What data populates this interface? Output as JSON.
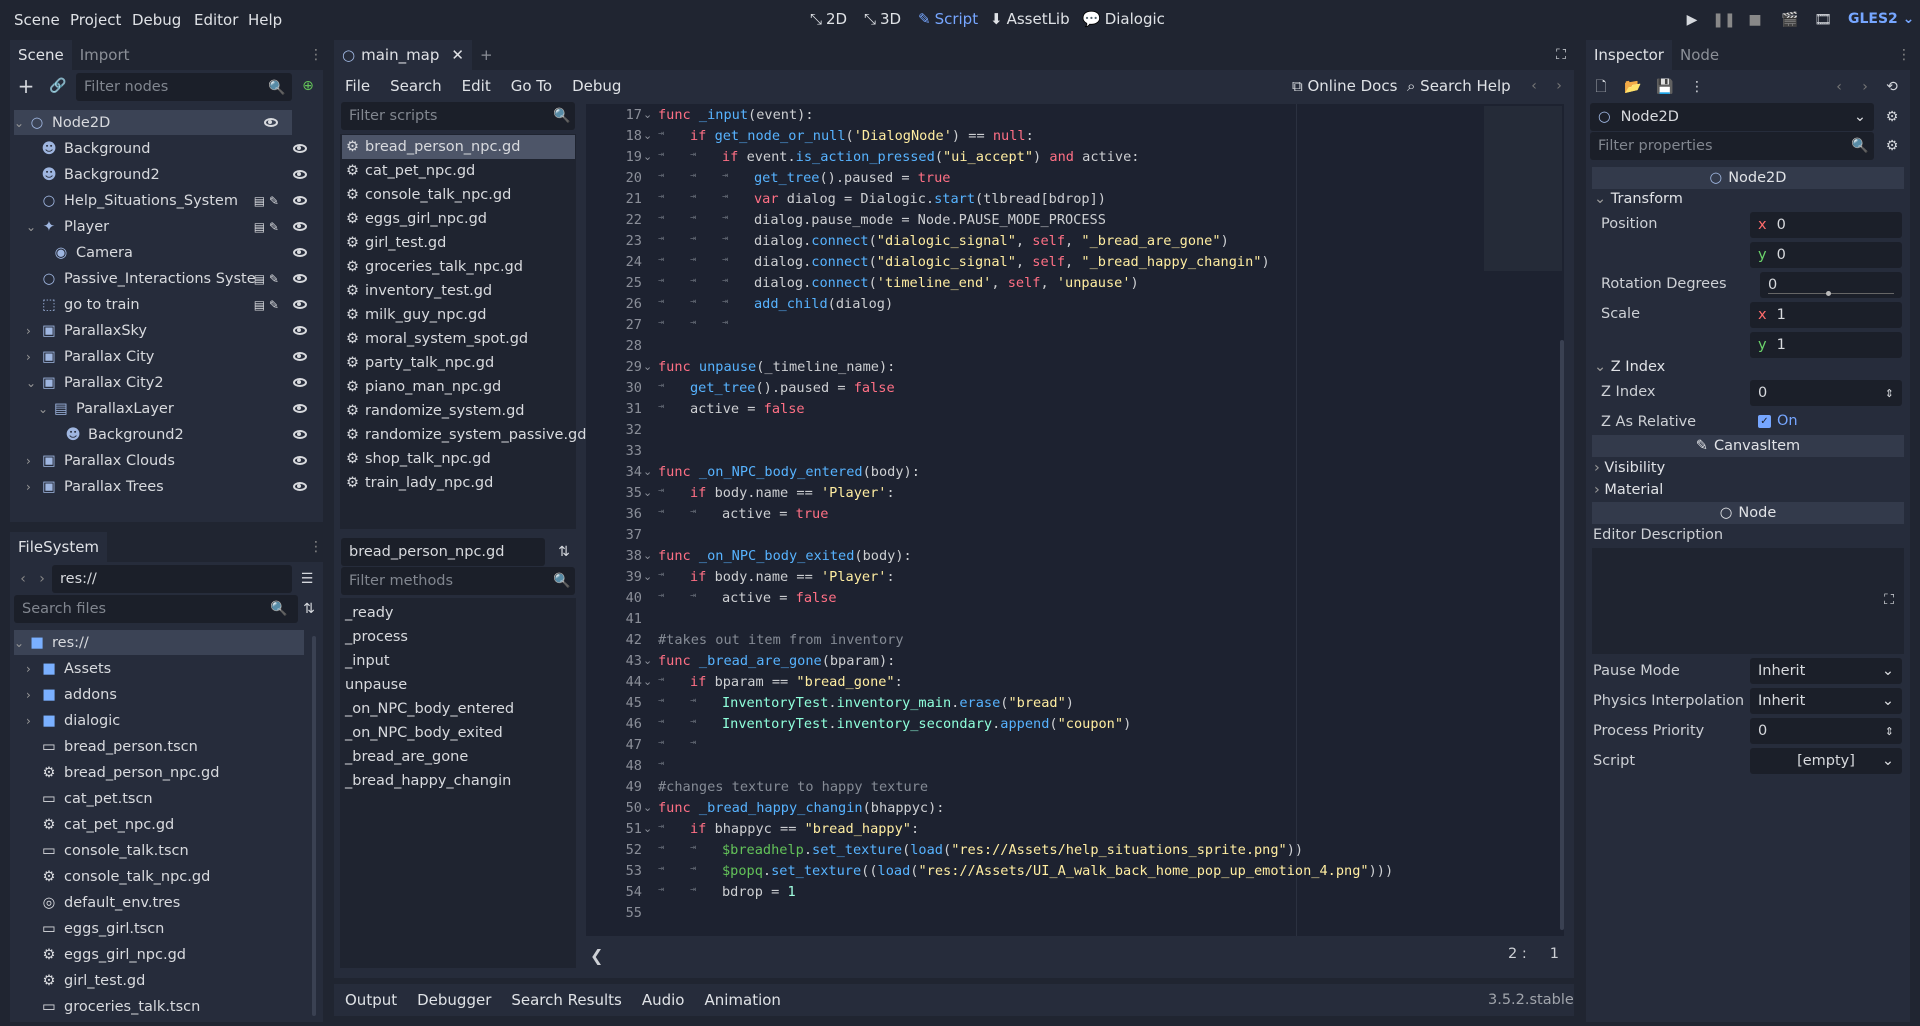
{
  "menus": [
    "Scene",
    "Project",
    "Debug",
    "Editor",
    "Help"
  ],
  "workspaces": [
    "2D",
    "3D",
    "Script",
    "AssetLib",
    "Dialogic"
  ],
  "active_workspace": "Script",
  "renderer": "GLES2",
  "scene_panel": {
    "tabs": [
      "Scene",
      "Import"
    ],
    "filter_placeholder": "Filter nodes",
    "nodes": [
      {
        "label": "Node2D",
        "depth": 0,
        "icon": "node2d-icon"
      },
      {
        "label": "Background",
        "depth": 1,
        "icon": "sprite-icon"
      },
      {
        "label": "Background2",
        "depth": 1,
        "icon": "sprite-icon"
      },
      {
        "label": "Help_Situations_System",
        "depth": 1,
        "icon": "node2d-icon"
      },
      {
        "label": "Player",
        "depth": 1,
        "icon": "kinematic-icon"
      },
      {
        "label": "Camera",
        "depth": 2,
        "icon": "camera-icon"
      },
      {
        "label": "Passive_Interactions Syste",
        "depth": 1,
        "icon": "node2d-icon"
      },
      {
        "label": "go to train",
        "depth": 1,
        "icon": "area-icon"
      },
      {
        "label": "ParallaxSky",
        "depth": 1,
        "icon": "parallax-icon"
      },
      {
        "label": "Parallax City",
        "depth": 1,
        "icon": "parallax-icon"
      },
      {
        "label": "Parallax City2",
        "depth": 1,
        "icon": "parallax-icon"
      },
      {
        "label": "ParallaxLayer",
        "depth": 2,
        "icon": "parallax-layer-icon"
      },
      {
        "label": "Background2",
        "depth": 3,
        "icon": "sprite-icon"
      },
      {
        "label": "Parallax Clouds",
        "depth": 1,
        "icon": "parallax-icon"
      },
      {
        "label": "Parallax Trees",
        "depth": 1,
        "icon": "parallax-icon"
      }
    ]
  },
  "filesystem": {
    "tab": "FileSystem",
    "path": "res://",
    "search_placeholder": "Search files",
    "items": [
      {
        "label": "res://",
        "icon": "folder-icon",
        "depth": 0
      },
      {
        "label": "Assets",
        "icon": "folder-icon",
        "depth": 1
      },
      {
        "label": "addons",
        "icon": "folder-icon",
        "depth": 1
      },
      {
        "label": "dialogic",
        "icon": "folder-icon",
        "depth": 1
      },
      {
        "label": "bread_person.tscn",
        "icon": "scene-icon",
        "depth": 1
      },
      {
        "label": "bread_person_npc.gd",
        "icon": "gear-icon",
        "depth": 1
      },
      {
        "label": "cat_pet.tscn",
        "icon": "scene-icon",
        "depth": 1
      },
      {
        "label": "cat_pet_npc.gd",
        "icon": "gear-icon",
        "depth": 1
      },
      {
        "label": "console_talk.tscn",
        "icon": "scene-icon",
        "depth": 1
      },
      {
        "label": "console_talk_npc.gd",
        "icon": "gear-icon",
        "depth": 1
      },
      {
        "label": "default_env.tres",
        "icon": "globe-icon",
        "depth": 1
      },
      {
        "label": "eggs_girl.tscn",
        "icon": "scene-icon",
        "depth": 1
      },
      {
        "label": "eggs_girl_npc.gd",
        "icon": "gear-icon",
        "depth": 1
      },
      {
        "label": "girl_test.gd",
        "icon": "gear-icon",
        "depth": 1
      },
      {
        "label": "groceries_talk.tscn",
        "icon": "scene-icon",
        "depth": 1
      }
    ]
  },
  "editor": {
    "scene_tab": "main_map",
    "menus": [
      "File",
      "Search",
      "Edit",
      "Go To",
      "Debug"
    ],
    "online_docs": "Online Docs",
    "search_help": "Search Help",
    "filter_scripts": "Filter scripts",
    "scripts": [
      "bread_person_npc.gd",
      "cat_pet_npc.gd",
      "console_talk_npc.gd",
      "eggs_girl_npc.gd",
      "girl_test.gd",
      "groceries_talk_npc.gd",
      "inventory_test.gd",
      "milk_guy_npc.gd",
      "moral_system_spot.gd",
      "party_talk_npc.gd",
      "piano_man_npc.gd",
      "randomize_system.gd",
      "randomize_system_passive.gd",
      "shop_talk_npc.gd",
      "train_lady_npc.gd"
    ],
    "current_script": "bread_person_npc.gd",
    "filter_methods": "Filter methods",
    "methods": [
      "_ready",
      "_process",
      "_input",
      "unpause",
      "_on_NPC_body_entered",
      "_on_NPC_body_exited",
      "_bread_are_gone",
      "_bread_happy_changin"
    ],
    "cursor_line": "2",
    "cursor_col": "1",
    "bottom_tabs": [
      "Output",
      "Debugger",
      "Search Results",
      "Audio",
      "Animation"
    ],
    "version": "3.5.2.stable",
    "code_lines": [
      {
        "n": "17",
        "fold": true,
        "indent": 0,
        "t": [
          [
            "kw",
            "func "
          ],
          [
            "fn",
            "_input"
          ],
          [
            "tx",
            "(event):"
          ]
        ]
      },
      {
        "n": "18",
        "fold": true,
        "indent": 1,
        "t": [
          [
            "kw",
            "if "
          ],
          [
            "fn",
            "get_node_or_null"
          ],
          [
            "tx",
            "("
          ],
          [
            "st",
            "'DialogNode'"
          ],
          [
            "tx",
            ") == "
          ],
          [
            "kw",
            "null"
          ],
          [
            "tx",
            ":"
          ]
        ]
      },
      {
        "n": "19",
        "fold": true,
        "indent": 2,
        "t": [
          [
            "kw",
            "if "
          ],
          [
            "tx",
            "event."
          ],
          [
            "fn",
            "is_action_pressed"
          ],
          [
            "tx",
            "("
          ],
          [
            "st",
            "\"ui_accept\""
          ],
          [
            "tx",
            ") "
          ],
          [
            "kw",
            "and "
          ],
          [
            "tx",
            "active:"
          ]
        ]
      },
      {
        "n": "20",
        "fold": false,
        "indent": 3,
        "t": [
          [
            "fn",
            "get_tree"
          ],
          [
            "tx",
            "().paused = "
          ],
          [
            "kw",
            "true"
          ]
        ]
      },
      {
        "n": "21",
        "fold": false,
        "indent": 3,
        "t": [
          [
            "kw",
            "var "
          ],
          [
            "tx",
            "dialog = Dialogic."
          ],
          [
            "fn",
            "start"
          ],
          [
            "tx",
            "(tlbread[bdrop])"
          ]
        ]
      },
      {
        "n": "22",
        "fold": false,
        "indent": 3,
        "t": [
          [
            "tx",
            "dialog.pause_mode = Node.PAUSE_MODE_PROCESS"
          ]
        ]
      },
      {
        "n": "23",
        "fold": false,
        "indent": 3,
        "t": [
          [
            "tx",
            "dialog."
          ],
          [
            "fn",
            "connect"
          ],
          [
            "tx",
            "("
          ],
          [
            "st",
            "\"dialogic_signal\""
          ],
          [
            "tx",
            ", "
          ],
          [
            "kw",
            "self"
          ],
          [
            "tx",
            ", "
          ],
          [
            "st",
            "\"_bread_are_gone\""
          ],
          [
            "tx",
            ")"
          ]
        ]
      },
      {
        "n": "24",
        "fold": false,
        "indent": 3,
        "t": [
          [
            "tx",
            "dialog."
          ],
          [
            "fn",
            "connect"
          ],
          [
            "tx",
            "("
          ],
          [
            "st",
            "\"dialogic_signal\""
          ],
          [
            "tx",
            ", "
          ],
          [
            "kw",
            "self"
          ],
          [
            "tx",
            ", "
          ],
          [
            "st",
            "\"_bread_happy_changin\""
          ],
          [
            "tx",
            ")"
          ]
        ]
      },
      {
        "n": "25",
        "fold": false,
        "indent": 3,
        "t": [
          [
            "tx",
            "dialog."
          ],
          [
            "fn",
            "connect"
          ],
          [
            "tx",
            "("
          ],
          [
            "st",
            "'timeline_end'"
          ],
          [
            "tx",
            ", "
          ],
          [
            "kw",
            "self"
          ],
          [
            "tx",
            ", "
          ],
          [
            "st",
            "'unpause'"
          ],
          [
            "tx",
            ")"
          ]
        ]
      },
      {
        "n": "26",
        "fold": false,
        "indent": 3,
        "t": [
          [
            "fn",
            "add_child"
          ],
          [
            "tx",
            "(dialog)"
          ]
        ]
      },
      {
        "n": "27",
        "fold": false,
        "indent": 3,
        "t": []
      },
      {
        "n": "28",
        "fold": false,
        "indent": 0,
        "t": []
      },
      {
        "n": "29",
        "fold": true,
        "indent": 0,
        "t": [
          [
            "kw",
            "func "
          ],
          [
            "fn",
            "unpause"
          ],
          [
            "tx",
            "(_timeline_name):"
          ]
        ]
      },
      {
        "n": "30",
        "fold": false,
        "indent": 1,
        "t": [
          [
            "fn",
            "get_tree"
          ],
          [
            "tx",
            "().paused = "
          ],
          [
            "kw",
            "false"
          ]
        ]
      },
      {
        "n": "31",
        "fold": false,
        "indent": 1,
        "t": [
          [
            "tx",
            "active = "
          ],
          [
            "kw",
            "false"
          ]
        ]
      },
      {
        "n": "32",
        "fold": false,
        "indent": 0,
        "t": []
      },
      {
        "n": "33",
        "fold": false,
        "indent": 0,
        "t": []
      },
      {
        "n": "34",
        "fold": true,
        "indent": 0,
        "t": [
          [
            "kw",
            "func "
          ],
          [
            "fn",
            "_on_NPC_body_entered"
          ],
          [
            "tx",
            "(body):"
          ]
        ]
      },
      {
        "n": "35",
        "fold": true,
        "indent": 1,
        "t": [
          [
            "kw",
            "if "
          ],
          [
            "tx",
            "body.name == "
          ],
          [
            "st",
            "'Player'"
          ],
          [
            "tx",
            ":"
          ]
        ]
      },
      {
        "n": "36",
        "fold": false,
        "indent": 2,
        "t": [
          [
            "tx",
            "active = "
          ],
          [
            "kw",
            "true"
          ]
        ]
      },
      {
        "n": "37",
        "fold": false,
        "indent": 0,
        "t": []
      },
      {
        "n": "38",
        "fold": true,
        "indent": 0,
        "t": [
          [
            "kw",
            "func "
          ],
          [
            "fn",
            "_on_NPC_body_exited"
          ],
          [
            "tx",
            "(body):"
          ]
        ]
      },
      {
        "n": "39",
        "fold": true,
        "indent": 1,
        "t": [
          [
            "kw",
            "if "
          ],
          [
            "tx",
            "body.name == "
          ],
          [
            "st",
            "'Player'"
          ],
          [
            "tx",
            ":"
          ]
        ]
      },
      {
        "n": "40",
        "fold": false,
        "indent": 2,
        "t": [
          [
            "tx",
            "active = "
          ],
          [
            "kw",
            "false"
          ]
        ]
      },
      {
        "n": "41",
        "fold": false,
        "indent": 0,
        "t": []
      },
      {
        "n": "42",
        "fold": false,
        "indent": 0,
        "t": [
          [
            "cm",
            "#takes out item from inventory"
          ]
        ]
      },
      {
        "n": "43",
        "fold": true,
        "indent": 0,
        "t": [
          [
            "kw",
            "func "
          ],
          [
            "fn",
            "_bread_are_gone"
          ],
          [
            "tx",
            "(bparam):"
          ]
        ]
      },
      {
        "n": "44",
        "fold": true,
        "indent": 1,
        "t": [
          [
            "kw",
            "if "
          ],
          [
            "tx",
            "bparam == "
          ],
          [
            "st",
            "\"bread_gone\""
          ],
          [
            "tx",
            ":"
          ]
        ]
      },
      {
        "n": "45",
        "fold": false,
        "indent": 2,
        "t": [
          [
            "bi",
            "InventoryTest"
          ],
          [
            "tx",
            "."
          ],
          [
            "bi",
            "inventory_main"
          ],
          [
            "tx",
            "."
          ],
          [
            "fn",
            "erase"
          ],
          [
            "tx",
            "("
          ],
          [
            "st",
            "\"bread\""
          ],
          [
            "tx",
            ")"
          ]
        ]
      },
      {
        "n": "46",
        "fold": false,
        "indent": 2,
        "t": [
          [
            "bi",
            "InventoryTest"
          ],
          [
            "tx",
            "."
          ],
          [
            "bi",
            "inventory_secondary"
          ],
          [
            "tx",
            "."
          ],
          [
            "fn",
            "append"
          ],
          [
            "tx",
            "("
          ],
          [
            "st",
            "\"coupon\""
          ],
          [
            "tx",
            ")"
          ]
        ]
      },
      {
        "n": "47",
        "fold": false,
        "indent": 2,
        "t": []
      },
      {
        "n": "48",
        "fold": false,
        "indent": 1,
        "t": []
      },
      {
        "n": "49",
        "fold": false,
        "indent": 0,
        "t": [
          [
            "cm",
            "#changes texture to happy texture"
          ]
        ]
      },
      {
        "n": "50",
        "fold": true,
        "indent": 0,
        "t": [
          [
            "kw",
            "func "
          ],
          [
            "fn",
            "_bread_happy_changin"
          ],
          [
            "tx",
            "(bhappyc):"
          ]
        ]
      },
      {
        "n": "51",
        "fold": true,
        "indent": 1,
        "t": [
          [
            "kw",
            "if "
          ],
          [
            "tx",
            "bhappyc == "
          ],
          [
            "st",
            "\"bread_happy\""
          ],
          [
            "tx",
            ":"
          ]
        ]
      },
      {
        "n": "52",
        "fold": false,
        "indent": 2,
        "t": [
          [
            "nd",
            "$breadhelp"
          ],
          [
            "tx",
            "."
          ],
          [
            "fn",
            "set_texture"
          ],
          [
            "tx",
            "("
          ],
          [
            "fn",
            "load"
          ],
          [
            "tx",
            "("
          ],
          [
            "st",
            "\"res://Assets/help_situations_sprite.png\""
          ],
          [
            "tx",
            "))"
          ]
        ]
      },
      {
        "n": "53",
        "fold": false,
        "indent": 2,
        "t": [
          [
            "nd",
            "$popq"
          ],
          [
            "tx",
            "."
          ],
          [
            "fn",
            "set_texture"
          ],
          [
            "tx",
            "(("
          ],
          [
            "fn",
            "load"
          ],
          [
            "tx",
            "("
          ],
          [
            "st",
            "\"res://Assets/UI_A_walk_back_home_pop_up_emotion_4.png\""
          ],
          [
            "tx",
            ")))"
          ]
        ]
      },
      {
        "n": "54",
        "fold": false,
        "indent": 2,
        "t": [
          [
            "tx",
            "bdrop = "
          ],
          [
            "nm",
            "1"
          ]
        ]
      },
      {
        "n": "55",
        "fold": false,
        "indent": 0,
        "t": []
      }
    ]
  },
  "inspector": {
    "tabs": [
      "Inspector",
      "Node"
    ],
    "node": "Node2D",
    "filter_placeholder": "Filter properties",
    "class_header": "Node2D",
    "transform_label": "Transform",
    "position_label": "Position",
    "position_x": "0",
    "position_y": "0",
    "rotation_label": "Rotation Degrees",
    "rotation": "0",
    "scale_label": "Scale",
    "scale_x": "1",
    "scale_y": "1",
    "zindex_section": "Z Index",
    "zindex_label": "Z Index",
    "zindex": "0",
    "zrel_label": "Z As Relative",
    "zrel": "On",
    "canvasitem": "CanvasItem",
    "visibility": "Visibility",
    "material": "Material",
    "node_header": "Node",
    "editor_desc": "Editor Description",
    "pause_label": "Pause Mode",
    "pause": "Inherit",
    "physics_label": "Physics Interpolation",
    "physics": "Inherit",
    "priority_label": "Process Priority",
    "priority": "0",
    "script_label": "Script",
    "script": "[empty]",
    "x_label": "x",
    "y_label": "y"
  },
  "colors": {
    "accent": "#76a6ff",
    "bg": "#202531",
    "panel": "#262c3b",
    "keyword": "#ff7085",
    "function": "#57b3ff",
    "string": "#ffeda1"
  }
}
